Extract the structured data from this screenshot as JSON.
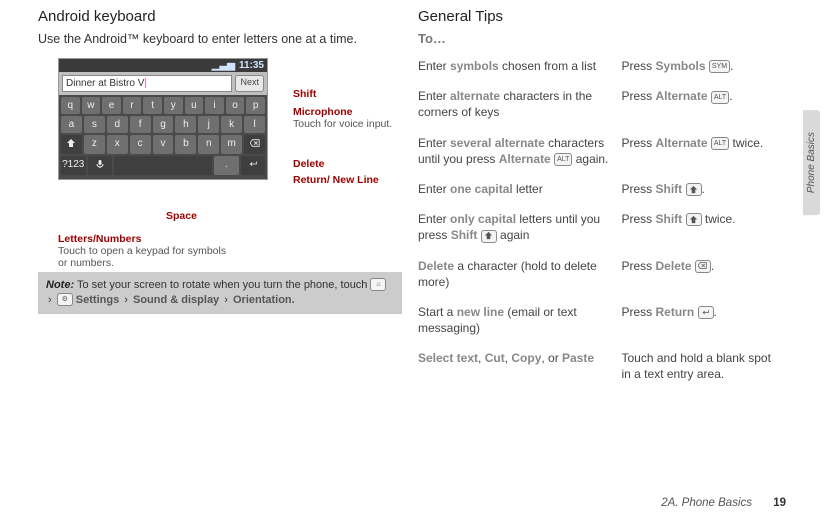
{
  "sidetab": "Phone Basics",
  "footer": {
    "section": "2A. Phone Basics",
    "page": "19"
  },
  "left": {
    "heading": "Android keyboard",
    "intro": "Use the Android™ keyboard to enter letters one at a time.",
    "phone": {
      "time": "11:35",
      "field_value": "Dinner at Bistro V",
      "next": "Next",
      "rows": [
        [
          "q",
          "w",
          "e",
          "r",
          "t",
          "y",
          "u",
          "i",
          "o",
          "p"
        ],
        [
          "a",
          "s",
          "d",
          "f",
          "g",
          "h",
          "j",
          "k",
          "l"
        ],
        [
          "SHIFT",
          "z",
          "x",
          "c",
          "v",
          "b",
          "n",
          "m",
          "DEL"
        ],
        [
          "?123",
          "MIC",
          "SPACE",
          ".",
          "RET"
        ]
      ]
    },
    "callouts": {
      "shift": "Shift",
      "mic": "Microphone",
      "mic_sub": "Touch for voice input.",
      "delete": "Delete",
      "ret": "Return/\nNew Line",
      "space": "Space",
      "ln": "Letters/Numbers",
      "ln_sub": "Touch to open a keypad for symbols or numbers."
    },
    "note": {
      "label": "Note:",
      "text": "To set your screen to rotate when you turn the phone, touch ",
      "crumbs": [
        "Settings",
        "Sound & display",
        "Orientation."
      ]
    }
  },
  "right": {
    "heading": "General Tips",
    "to": "To…",
    "rows": [
      {
        "l1": "Enter ",
        "lk": "symbols",
        "l2": " chosen from a list",
        "r1": "Press ",
        "rk": "Symbols",
        "cap": "SYM",
        "r2": "."
      },
      {
        "l1": "Enter ",
        "lk": "alternate",
        "l2": " characters in the corners of keys",
        "r1": "Press ",
        "rk": "Alternate",
        "cap": "ALT",
        "r2": "."
      },
      {
        "l1": "Enter ",
        "lk": "several alternate",
        "l2": " characters until you press ",
        "lk2": "Alternate",
        "lcap": "ALT",
        "l3": " again.",
        "r1": "Press ",
        "rk": "Alternate",
        "cap": "ALT",
        "r2": " twice."
      },
      {
        "l1": "Enter ",
        "lk": "one capital",
        "l2": " letter",
        "r1": "Press ",
        "rk": "Shift",
        "cap": "SHIFT",
        "r2": "."
      },
      {
        "l1": "Enter ",
        "lk": "only capital",
        "l2": " letters until you press ",
        "lk2": "Shift",
        "lcap": "SHIFT",
        "l3": " again",
        "r1": "Press ",
        "rk": "Shift",
        "cap": "SHIFT",
        "r2": " twice."
      },
      {
        "l1": "",
        "lk": "Delete",
        "l2": " a character (hold to delete more)",
        "r1": "Press ",
        "rk": "Delete",
        "cap": "DEL",
        "r2": "."
      },
      {
        "l1": "Start a ",
        "lk": "new line",
        "l2": " (email or text messaging)",
        "r1": "Press ",
        "rk": "Return",
        "cap": "RET",
        "r2": "."
      },
      {
        "l1": "",
        "lk": "Select text",
        "l2": ", ",
        "lk2": "Cut",
        "l3": ", ",
        "lk3": "Copy",
        "l4": ", or ",
        "lk4": "Paste",
        "r1": "Touch and hold a blank spot in a text entry area.",
        "rk": "",
        "cap": "",
        "r2": ""
      }
    ]
  }
}
